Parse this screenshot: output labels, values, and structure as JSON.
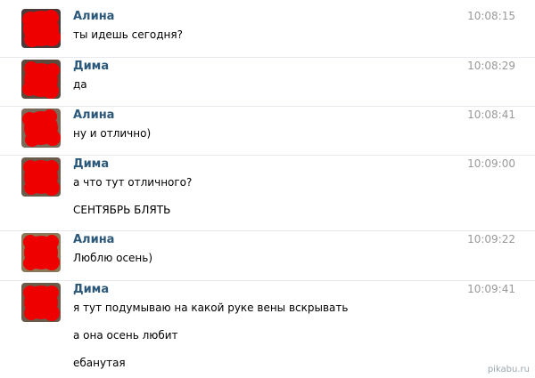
{
  "messages": [
    {
      "author": "Алина",
      "time": "10:08:15",
      "lines": [
        "ты идешь сегодня?"
      ]
    },
    {
      "author": "Дима",
      "time": "10:08:29",
      "lines": [
        "да"
      ]
    },
    {
      "author": "Алина",
      "time": "10:08:41",
      "lines": [
        "ну и отлично)"
      ]
    },
    {
      "author": "Дима",
      "time": "10:09:00",
      "lines": [
        "а что тут отличного?",
        "СЕНТЯБРЬ БЛЯТЬ"
      ]
    },
    {
      "author": "Алина",
      "time": "10:09:22",
      "lines": [
        "Люблю осень)"
      ]
    },
    {
      "author": "Дима",
      "time": "10:09:41",
      "lines": [
        "я тут подумываю на какой руке вены вскрывать",
        "а она осень любит",
        "ебанутая"
      ]
    }
  ],
  "watermark": "pikabu.ru",
  "colors": {
    "author": "#2b587a",
    "time": "#999999",
    "text": "#000000",
    "avatar_redaction": "#ee0000"
  },
  "icons": {
    "avatar": "avatar-redacted-red-blob"
  }
}
